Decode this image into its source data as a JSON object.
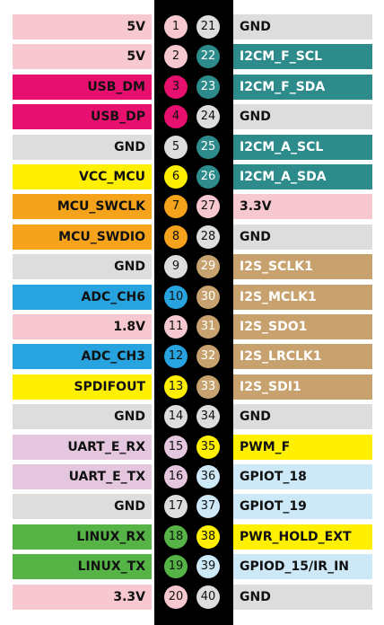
{
  "colors": {
    "power_5v": "#f8c8d0",
    "ground": "#dddddd",
    "usb": "#e8106e",
    "i2c": "#2e8b8b",
    "vcc_mcu": "#ffef00",
    "swd": "#f5a31a",
    "power_3v3": "#f8c8d0",
    "i2s": "#c8a26e",
    "adc": "#27a4e0",
    "spdif": "#ffef00",
    "uart": "#e4c6de",
    "pwm": "#ffef00",
    "gpio": "#cde9f8",
    "linux": "#56b447",
    "power_1v8": "#f8c8d0",
    "header": "#000000"
  },
  "rows": [
    {
      "left": {
        "pin": "1",
        "label": "5V",
        "color": "#f8c8d0",
        "text_color": "dark"
      },
      "right": {
        "pin": "21",
        "label": "GND",
        "color": "#dddddd",
        "text_color": "dark"
      }
    },
    {
      "left": {
        "pin": "2",
        "label": "5V",
        "color": "#f8c8d0",
        "text_color": "dark"
      },
      "right": {
        "pin": "22",
        "label": "I2CM_F_SCL",
        "color": "#2e8b8b",
        "text_color": "light"
      }
    },
    {
      "left": {
        "pin": "3",
        "label": "USB_DM",
        "color": "#e8106e",
        "text_color": "dark"
      },
      "right": {
        "pin": "23",
        "label": "I2CM_F_SDA",
        "color": "#2e8b8b",
        "text_color": "light"
      }
    },
    {
      "left": {
        "pin": "4",
        "label": "USB_DP",
        "color": "#e8106e",
        "text_color": "dark"
      },
      "right": {
        "pin": "24",
        "label": "GND",
        "color": "#dddddd",
        "text_color": "dark"
      }
    },
    {
      "left": {
        "pin": "5",
        "label": "GND",
        "color": "#dddddd",
        "text_color": "dark"
      },
      "right": {
        "pin": "25",
        "label": "I2CM_A_SCL",
        "color": "#2e8b8b",
        "text_color": "light"
      }
    },
    {
      "left": {
        "pin": "6",
        "label": "VCC_MCU",
        "color": "#ffef00",
        "text_color": "dark"
      },
      "right": {
        "pin": "26",
        "label": "I2CM_A_SDA",
        "color": "#2e8b8b",
        "text_color": "light"
      }
    },
    {
      "left": {
        "pin": "7",
        "label": "MCU_SWCLK",
        "color": "#f5a31a",
        "text_color": "dark"
      },
      "right": {
        "pin": "27",
        "label": "3.3V",
        "color": "#f8c8d0",
        "text_color": "dark"
      }
    },
    {
      "left": {
        "pin": "8",
        "label": "MCU_SWDIO",
        "color": "#f5a31a",
        "text_color": "dark"
      },
      "right": {
        "pin": "28",
        "label": "GND",
        "color": "#dddddd",
        "text_color": "dark"
      }
    },
    {
      "left": {
        "pin": "9",
        "label": "GND",
        "color": "#dddddd",
        "text_color": "dark"
      },
      "right": {
        "pin": "29",
        "label": "I2S_SCLK1",
        "color": "#c8a26e",
        "text_color": "light"
      }
    },
    {
      "left": {
        "pin": "10",
        "label": "ADC_CH6",
        "color": "#27a4e0",
        "text_color": "dark"
      },
      "right": {
        "pin": "30",
        "label": "I2S_MCLK1",
        "color": "#c8a26e",
        "text_color": "light"
      }
    },
    {
      "left": {
        "pin": "11",
        "label": "1.8V",
        "color": "#f8c8d0",
        "text_color": "dark"
      },
      "right": {
        "pin": "31",
        "label": "I2S_SDO1",
        "color": "#c8a26e",
        "text_color": "light"
      }
    },
    {
      "left": {
        "pin": "12",
        "label": "ADC_CH3",
        "color": "#27a4e0",
        "text_color": "dark"
      },
      "right": {
        "pin": "32",
        "label": "I2S_LRCLK1",
        "color": "#c8a26e",
        "text_color": "light"
      }
    },
    {
      "left": {
        "pin": "13",
        "label": "SPDIFOUT",
        "color": "#ffef00",
        "text_color": "dark"
      },
      "right": {
        "pin": "33",
        "label": "I2S_SDI1",
        "color": "#c8a26e",
        "text_color": "light"
      }
    },
    {
      "left": {
        "pin": "14",
        "label": "GND",
        "color": "#dddddd",
        "text_color": "dark"
      },
      "right": {
        "pin": "34",
        "label": "GND",
        "color": "#dddddd",
        "text_color": "dark"
      }
    },
    {
      "left": {
        "pin": "15",
        "label": "UART_E_RX",
        "color": "#e4c6de",
        "text_color": "dark"
      },
      "right": {
        "pin": "35",
        "label": "PWM_F",
        "color": "#ffef00",
        "text_color": "dark"
      }
    },
    {
      "left": {
        "pin": "16",
        "label": "UART_E_TX",
        "color": "#e4c6de",
        "text_color": "dark"
      },
      "right": {
        "pin": "36",
        "label": "GPIOT_18",
        "color": "#cde9f8",
        "text_color": "dark"
      }
    },
    {
      "left": {
        "pin": "17",
        "label": "GND",
        "color": "#dddddd",
        "text_color": "dark"
      },
      "right": {
        "pin": "37",
        "label": "GPIOT_19",
        "color": "#cde9f8",
        "text_color": "dark"
      }
    },
    {
      "left": {
        "pin": "18",
        "label": "LINUX_RX",
        "color": "#56b447",
        "text_color": "dark"
      },
      "right": {
        "pin": "38",
        "label": "PWR_HOLD_EXT",
        "color": "#ffef00",
        "text_color": "dark"
      }
    },
    {
      "left": {
        "pin": "19",
        "label": "LINUX_TX",
        "color": "#56b447",
        "text_color": "dark"
      },
      "right": {
        "pin": "39",
        "label": "GPIOD_15/IR_IN",
        "color": "#cde9f8",
        "text_color": "dark"
      }
    },
    {
      "left": {
        "pin": "20",
        "label": "3.3V",
        "color": "#f8c8d0",
        "text_color": "dark"
      },
      "right": {
        "pin": "40",
        "label": "GND",
        "color": "#dddddd",
        "text_color": "dark"
      }
    }
  ]
}
